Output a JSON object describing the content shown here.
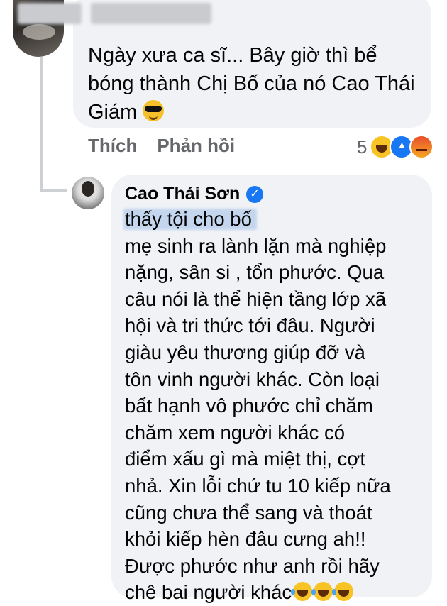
{
  "comment": {
    "text_before_emoji": "Ngày xưa ca sĩ... Bây giờ thì bể bóng thành Chị Bố của nó Cao Thái Giám ",
    "emoji": "sunglasses-emoji"
  },
  "actions": {
    "like_label": "Thích",
    "reply_label": "Phản hồi"
  },
  "reactions": {
    "count": "5",
    "types": [
      "haha",
      "like",
      "angry"
    ]
  },
  "reply": {
    "author": "Cao Thái Sơn",
    "verified": true,
    "text": "                              thấy tội cho bố\nmẹ sinh ra lành lặn mà nghiệp\nnặng, sân si , tổn phước. Qua\ncâu nói là thể hiện tầng lớp xã\nhội và tri thức tới đâu. Người\ngiàu yêu thương giúp đỡ và\ntôn vinh người khác. Còn loại\nbất hạnh vô phước chỉ chăm\nchăm xem người khác có\nđiểm xấu gì mà miệt thị, cợt\nnhả. Xin lỗi chứ tu 10 kiếp nữa\ncũng chưa thể sang và thoát\nkhỏi kiếp hèn đâu cưng ah!!\nĐược phước như anh rồi hãy\nchê bai người khác",
    "trailing_emojis": [
      "laughing-emoji",
      "laughing-emoji",
      "laughing-emoji"
    ]
  },
  "colors": {
    "bubble_bg": "#f0f2f5",
    "meta_text": "#65676b",
    "verified_blue": "#1877f2"
  }
}
